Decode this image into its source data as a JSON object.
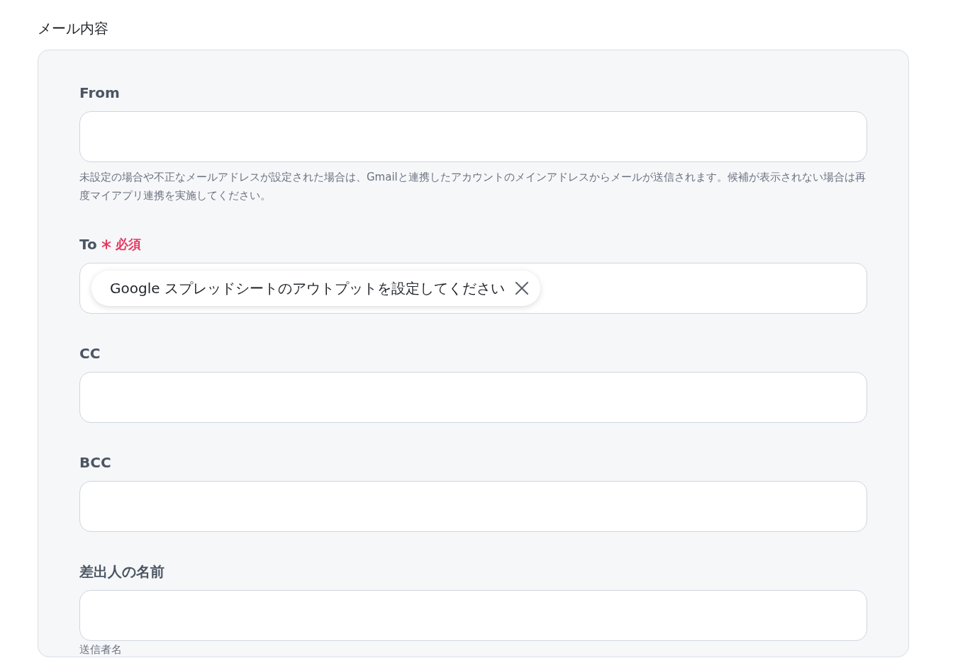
{
  "section_title": "メール内容",
  "fields": [
    {
      "label": "From",
      "required": false,
      "help": "未設定の場合や不正なメールアドレスが設定された場合は、Gmailと連携したアカウントのメインアドレスからメールが送信されます。候補が表示されない場合は再度マイアプリ連携を実施してください。"
    },
    {
      "label": "To",
      "required": true,
      "required_label": "必須",
      "chips": [
        "Google スプレッドシートのアウトプットを設定してください"
      ]
    },
    {
      "label": "CC",
      "required": false
    },
    {
      "label": "BCC",
      "required": false
    },
    {
      "label": "差出人の名前",
      "required": false,
      "help": "送信者名"
    }
  ]
}
